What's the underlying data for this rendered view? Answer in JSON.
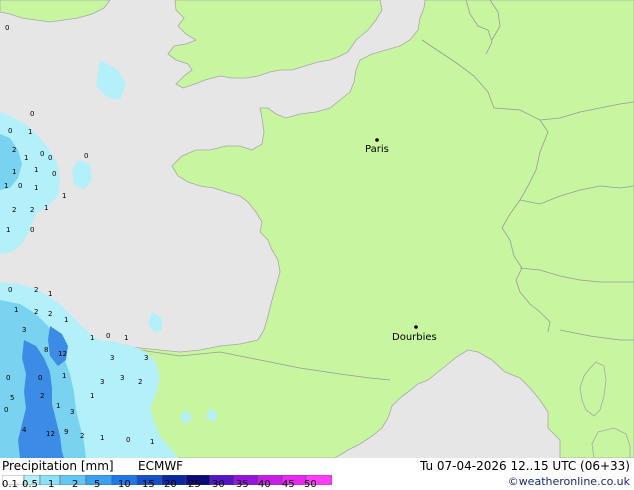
{
  "map": {
    "colors": {
      "sea": "#e6e6e6",
      "land": "#c8f5a0",
      "border": "#9a9a9a",
      "coast": "#a8a8a8",
      "precip_light": "#b4f0fa",
      "precip_mid": "#78d2f0",
      "precip_heavy": "#3c8ce6"
    },
    "cities": [
      {
        "name": "Paris"
      },
      {
        "name": "Dourbies"
      }
    ],
    "point_values": [
      "0",
      "0",
      "0",
      "1",
      "2",
      "0",
      "1",
      "1",
      "0",
      "1",
      "0",
      "1",
      "0",
      "1",
      "2",
      "2",
      "1",
      "1",
      "0",
      "0",
      "1",
      "0",
      "2",
      "1",
      "1",
      "2",
      "2",
      "3",
      "1",
      "8",
      "12",
      "1",
      "0",
      "1",
      "3",
      "3",
      "0",
      "0",
      "1",
      "3",
      "2",
      "3",
      "5",
      "2",
      "1",
      "4",
      "12",
      "9",
      "2",
      "1",
      "0",
      "3",
      "1",
      "0",
      "1"
    ]
  },
  "footer": {
    "title": "Precipitation [mm]",
    "model": "ECMWF",
    "validity": "Tu 07-04-2026 12..15 UTC (06+33)",
    "credit": "©weatheronline.co.uk"
  },
  "legend": {
    "labels": [
      "0.1",
      "0.5",
      "1",
      "2",
      "5",
      "10",
      "15",
      "20",
      "25",
      "30",
      "35",
      "40",
      "45",
      "50"
    ],
    "colors": [
      "#ffffff",
      "#b4f0fa",
      "#8ce0fa",
      "#64c8f5",
      "#3ca0f0",
      "#1e78e6",
      "#1450c8",
      "#0a28a0",
      "#0a0a78",
      "#5a14c8",
      "#9614dc",
      "#c81ee6",
      "#e628f0",
      "#ff3cff"
    ]
  }
}
